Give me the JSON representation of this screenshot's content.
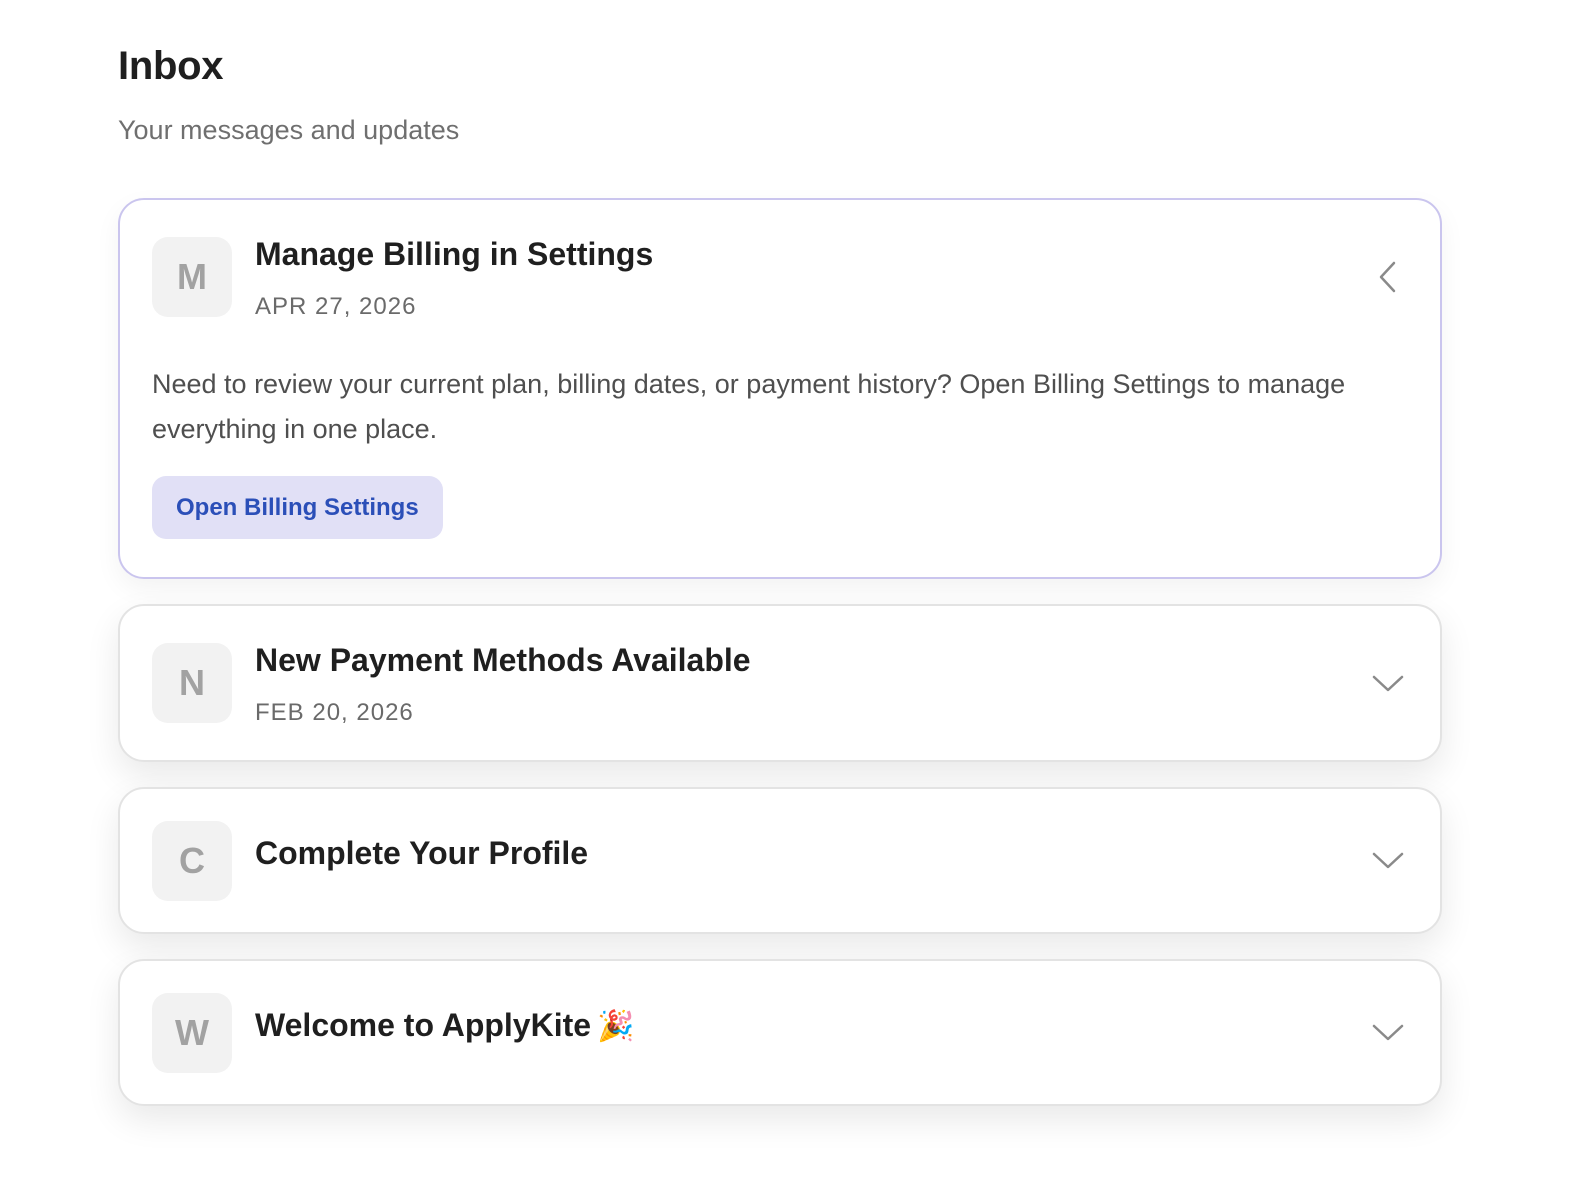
{
  "header": {
    "title": "Inbox",
    "subtitle": "Your messages and updates"
  },
  "messages": [
    {
      "avatar": "M",
      "title": "Manage Billing in Settings",
      "date": "APR 27, 2026",
      "expanded": true,
      "chevron_icon": "chevron-left-icon",
      "body": "Need to review your current plan, billing dates, or payment history? Open Billing Settings to manage everything in one place.",
      "action_label": "Open Billing Settings"
    },
    {
      "avatar": "N",
      "title": "New Payment Methods Available",
      "date": "FEB 20, 2026",
      "expanded": false,
      "chevron_icon": "chevron-down-icon"
    },
    {
      "avatar": "C",
      "title": "Complete Your Profile",
      "expanded": false,
      "chevron_icon": "chevron-down-icon"
    },
    {
      "avatar": "W",
      "title": "Welcome to ApplyKite",
      "title_emoji": "🎉",
      "expanded": false,
      "chevron_icon": "chevron-down-icon"
    }
  ],
  "colors": {
    "accent_border": "#cac5ee",
    "button_bg": "#e1e0f6",
    "button_text": "#2b4fb8",
    "avatar_bg": "#f2f2f2"
  }
}
